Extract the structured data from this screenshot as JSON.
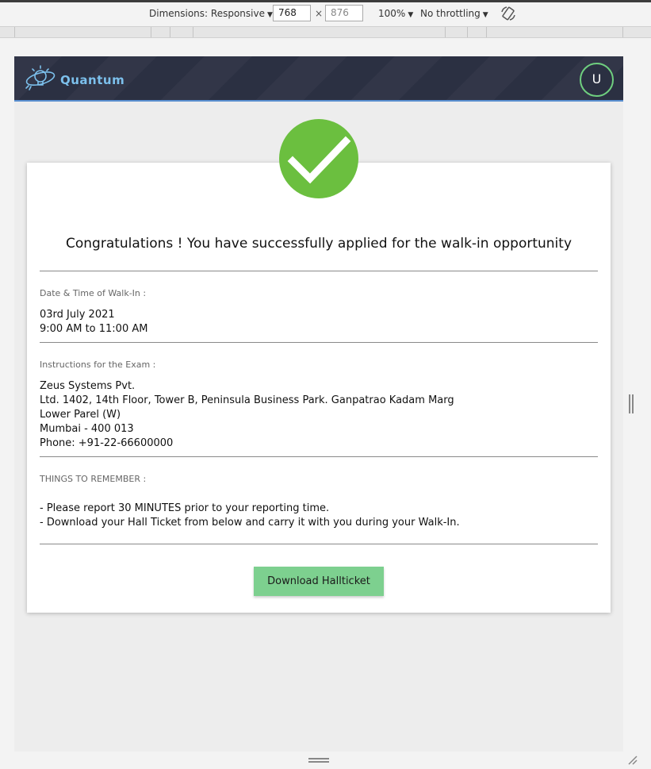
{
  "devtools": {
    "dimensions_label": "Dimensions: Responsive",
    "width_value": "768",
    "height_value": "876",
    "times": "×",
    "zoom": "100%",
    "throttling": "No throttling",
    "caret": "▼"
  },
  "header": {
    "brand": "Quantum",
    "avatar_initial": "U",
    "logo_icon": "lightbulb-orbit-icon"
  },
  "success": {
    "icon": "checkmark-icon",
    "heading": "Congratulations ! You have successfully applied for the walk-in opportunity"
  },
  "walkin": {
    "label": "Date & Time of Walk-In :",
    "date": "03rd July 2021",
    "time": "9:00 AM to 11:00 AM"
  },
  "instructions": {
    "label": "Instructions for the Exam :",
    "lines": [
      "Zeus Systems Pvt.",
      "Ltd. 1402, 14th Floor, Tower B, Peninsula Business Park. Ganpatrao Kadam Marg",
      "Lower Parel (W)",
      "Mumbai - 400 013",
      "Phone: +91-22-66600000"
    ]
  },
  "remember": {
    "label": "THINGS TO REMEMBER :",
    "lines": [
      "- Please report 30 MINUTES prior to your reporting time.",
      "- Download your Hall Ticket from below and carry it with you during your Walk-In."
    ]
  },
  "actions": {
    "download_label": "Download Hallticket"
  },
  "colors": {
    "header_bg": "#2b3042",
    "brand": "#7cc0ec",
    "success_green": "#6bbf3f",
    "button_green": "#7dd08f",
    "avatar_ring": "#6fcf7f"
  }
}
